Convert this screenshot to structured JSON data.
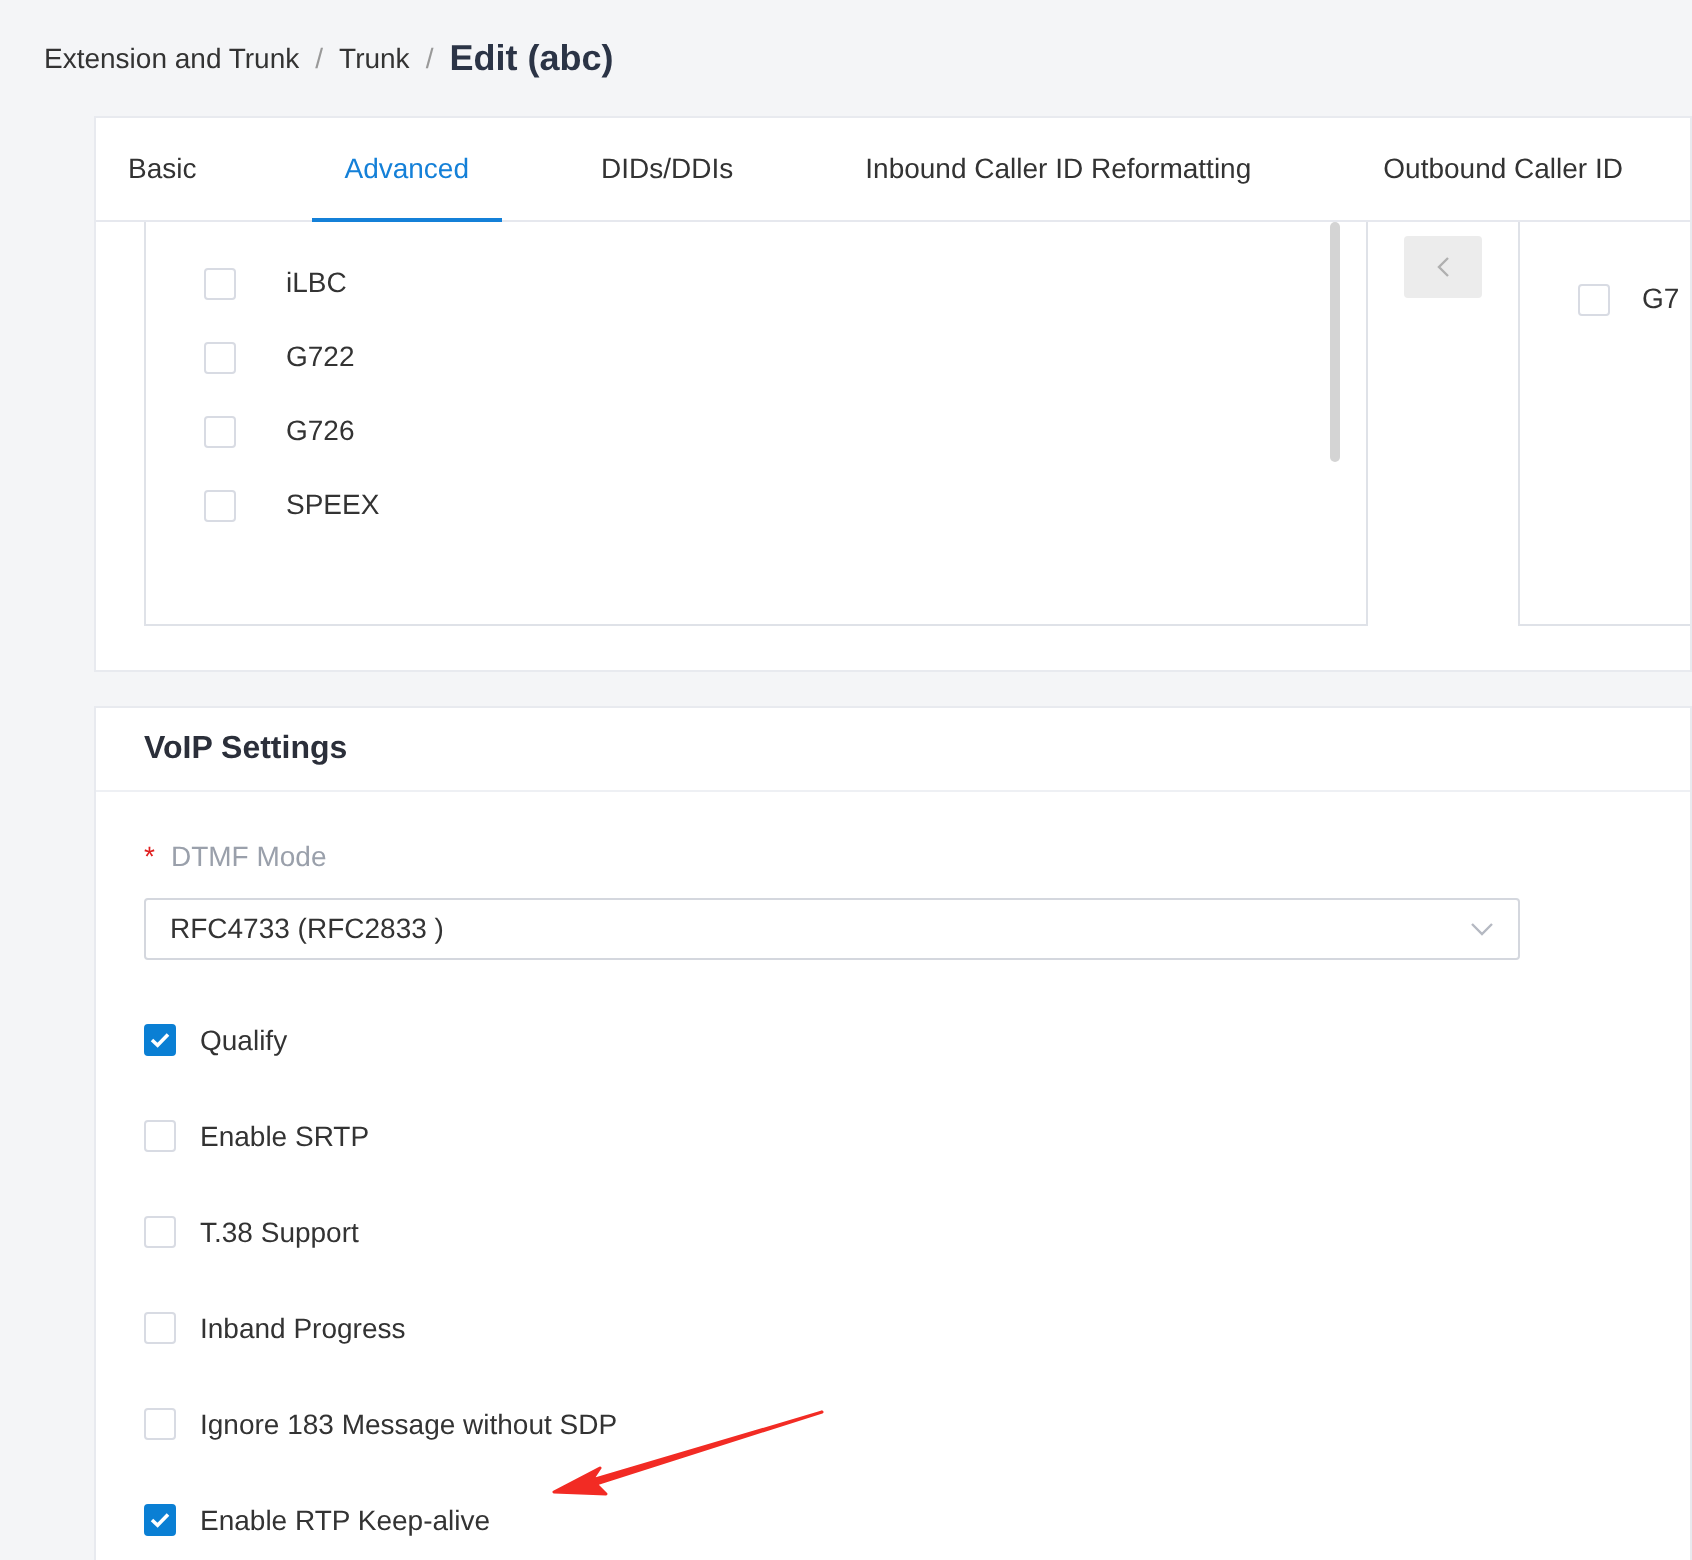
{
  "breadcrumb": [
    {
      "label": "Extension and Trunk",
      "current": false
    },
    {
      "label": "Trunk",
      "current": false
    },
    {
      "label": "Edit (abc)",
      "current": true
    }
  ],
  "breadcrumb_separators": [
    "/",
    "/"
  ],
  "tabs": [
    {
      "label": "Basic",
      "selected": false
    },
    {
      "label": "Advanced",
      "selected": true
    },
    {
      "label": "DIDs/DDIs",
      "selected": false
    },
    {
      "label": "Inbound Caller ID Reformatting",
      "selected": false
    },
    {
      "label": "Outbound Caller ID",
      "selected": false
    }
  ],
  "codecs": {
    "available": [
      {
        "label": "iLBC",
        "checked": false
      },
      {
        "label": "G722",
        "checked": false
      },
      {
        "label": "G726",
        "checked": false
      },
      {
        "label": "SPEEX",
        "checked": false
      }
    ],
    "selected": [
      {
        "label": "G7",
        "checked": false
      }
    ]
  },
  "voip_settings": {
    "title": "VoIP Settings",
    "dtmf_mode": {
      "label": "DTMF Mode",
      "required": true,
      "required_mark": "*",
      "value": "RFC4733 (RFC2833 )"
    },
    "options": [
      {
        "label": "Qualify",
        "checked": true
      },
      {
        "label": "Enable SRTP",
        "checked": false
      },
      {
        "label": "T.38 Support",
        "checked": false
      },
      {
        "label": "Inband Progress",
        "checked": false
      },
      {
        "label": "Ignore 183 Message without SDP",
        "checked": false
      },
      {
        "label": "Enable RTP Keep-alive",
        "checked": true
      }
    ]
  }
}
